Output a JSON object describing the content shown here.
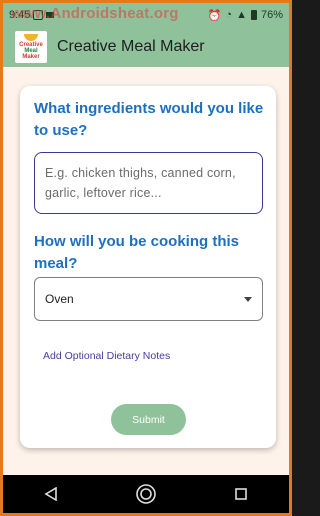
{
  "status_bar": {
    "time": "9:45",
    "battery_percent": "76%"
  },
  "watermark": "www.Androidsheat.org",
  "app_bar": {
    "logo_text_line1": "Creative",
    "logo_text_line2": "Meal",
    "logo_text_line3": "Maker",
    "title": "Creative Meal Maker"
  },
  "form": {
    "ingredients_question": "What ingredients would you like to use?",
    "ingredients_placeholder": "E.g. chicken thighs, canned corn, garlic, leftover rice...",
    "cooking_question": "How will you be cooking this meal?",
    "cooking_method_selected": "Oven",
    "dietary_notes_link": "Add Optional Dietary Notes",
    "submit_label": "Submit"
  },
  "colors": {
    "accent_green": "#8fc19a",
    "question_blue": "#1f6fbf",
    "link_purple": "#4a3aa0"
  }
}
